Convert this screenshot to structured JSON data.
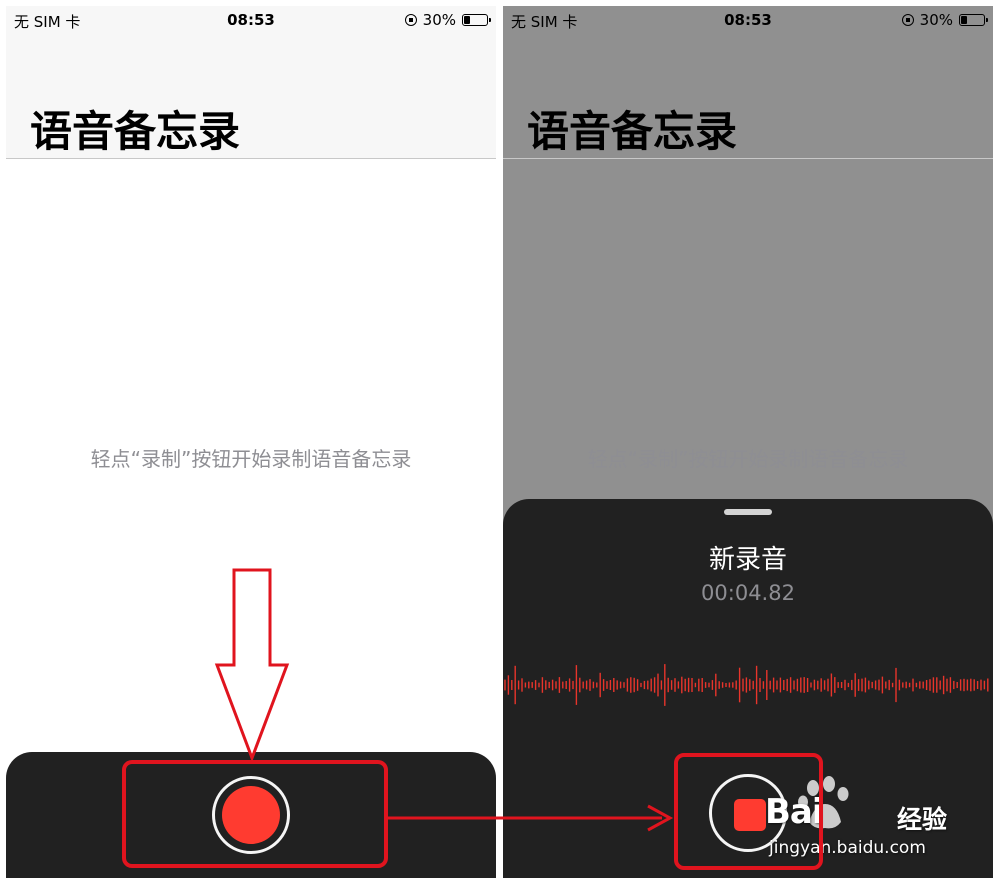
{
  "status_bar": {
    "carrier": "无 SIM 卡",
    "time": "08:53",
    "battery_percent": "30%",
    "battery_level": 0.3
  },
  "app": {
    "title": "语音备忘录",
    "empty_hint": "轻点“录制”按钮开始录制语音备忘录"
  },
  "recording": {
    "title": "新录音",
    "elapsed": "00:04.82"
  },
  "watermark": {
    "brand": "Bai",
    "brand2": "经验",
    "url": "jingyan.baidu.com"
  },
  "colors": {
    "record_red": "#ff3b30",
    "annotation_red": "#e0141e",
    "dark_bar": "#212121",
    "dim_overlay": "#909090"
  },
  "icons": {
    "record": "record-button-icon",
    "stop": "stop-button-icon",
    "lock": "orientation-lock-icon",
    "battery": "battery-icon"
  }
}
